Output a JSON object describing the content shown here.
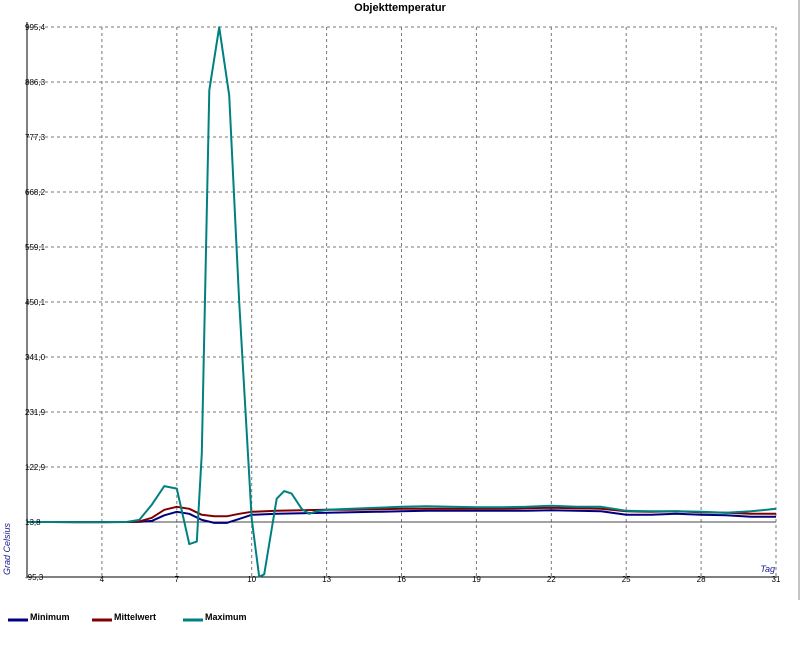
{
  "chart_data": {
    "type": "line",
    "title": "Objekttemperatur",
    "xlabel": "Tag",
    "ylabel": "Grad Celsius",
    "xlim": [
      1,
      31
    ],
    "ylim": [
      -95.3,
      995.4
    ],
    "x_ticks": [
      4,
      7,
      10,
      13,
      16,
      19,
      22,
      25,
      28,
      31
    ],
    "y_tick_labels": [
      "-95,3",
      "13,8",
      "122,9",
      "231,9",
      "341,0",
      "450,1",
      "559,1",
      "668,2",
      "777,3",
      "886,3",
      "995,4"
    ],
    "grid": true,
    "legend_position": "bottom-left",
    "series": [
      {
        "name": "Minimum",
        "color": "#000080",
        "x": [
          1,
          2,
          3,
          4,
          5,
          5.5,
          6,
          6.5,
          7,
          7.5,
          8,
          8.5,
          9,
          9.5,
          10,
          11,
          12,
          13,
          14,
          15,
          16,
          17,
          18,
          19,
          20,
          21,
          22,
          23,
          24,
          25,
          26,
          27,
          28,
          29,
          30,
          31
        ],
        "y": [
          13.8,
          13.8,
          13.5,
          13.5,
          13.8,
          14,
          16,
          27,
          34,
          30,
          18,
          12,
          12,
          20,
          28,
          30,
          31,
          32,
          33,
          34,
          35,
          36,
          36,
          36,
          36,
          36,
          37,
          36,
          35,
          28,
          28,
          30,
          28,
          27,
          24,
          24
        ]
      },
      {
        "name": "Mittelwert",
        "color": "#800000",
        "x": [
          1,
          2,
          3,
          4,
          5,
          5.5,
          6,
          6.5,
          7,
          7.5,
          8,
          8.5,
          9,
          9.5,
          10,
          11,
          12,
          13,
          14,
          15,
          16,
          17,
          18,
          19,
          20,
          21,
          22,
          23,
          24,
          25,
          26,
          27,
          28,
          29,
          30,
          31
        ],
        "y": [
          13.8,
          13.8,
          13.5,
          13.5,
          13.8,
          15,
          22,
          38,
          44,
          40,
          28,
          25,
          25,
          30,
          34,
          36,
          37,
          38,
          38,
          39,
          40,
          40,
          40,
          40,
          40,
          41,
          42,
          41,
          40,
          35,
          34,
          35,
          33,
          32,
          30,
          30
        ]
      },
      {
        "name": "Maximum",
        "color": "#008080",
        "x": [
          1,
          2,
          3,
          4,
          5,
          5.5,
          6,
          6.5,
          7,
          7.5,
          7.8,
          8,
          8.3,
          8.7,
          9.1,
          9.5,
          10,
          10.3,
          10.5,
          11,
          11.3,
          11.6,
          12,
          12.3,
          12.6,
          13,
          14,
          15,
          16,
          17,
          18,
          19,
          20,
          21,
          22,
          23,
          24,
          25,
          26,
          27,
          28,
          29,
          30,
          31
        ],
        "y": [
          13.8,
          13.8,
          13.5,
          13.5,
          14,
          18,
          48,
          85,
          80,
          -30,
          -25,
          150,
          870,
          995,
          860,
          450,
          20,
          -95,
          -90,
          60,
          75,
          70,
          40,
          30,
          35,
          38,
          40,
          42,
          44,
          45,
          44,
          43,
          43,
          44,
          46,
          44,
          44,
          36,
          35,
          35,
          34,
          32,
          35,
          40
        ]
      }
    ]
  }
}
